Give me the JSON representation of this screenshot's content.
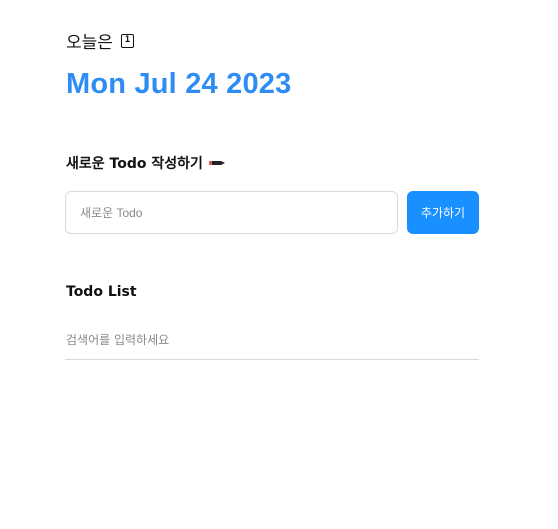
{
  "header": {
    "today_label": "오늘은",
    "calendar_icon": "calendar-icon",
    "calendar_glyph": "1",
    "date": "Mon Jul 24 2023",
    "date_color": "#2e8df5"
  },
  "editor": {
    "title": "새로운 Todo 작성하기",
    "title_icon": "pencil-icon",
    "input_placeholder": "새로운 Todo",
    "input_value": "",
    "add_button_label": "추가하기",
    "accent_color": "#1890ff"
  },
  "list": {
    "title": "Todo List",
    "search_placeholder": "검색어를 입력하세요",
    "search_value": "",
    "items": []
  }
}
